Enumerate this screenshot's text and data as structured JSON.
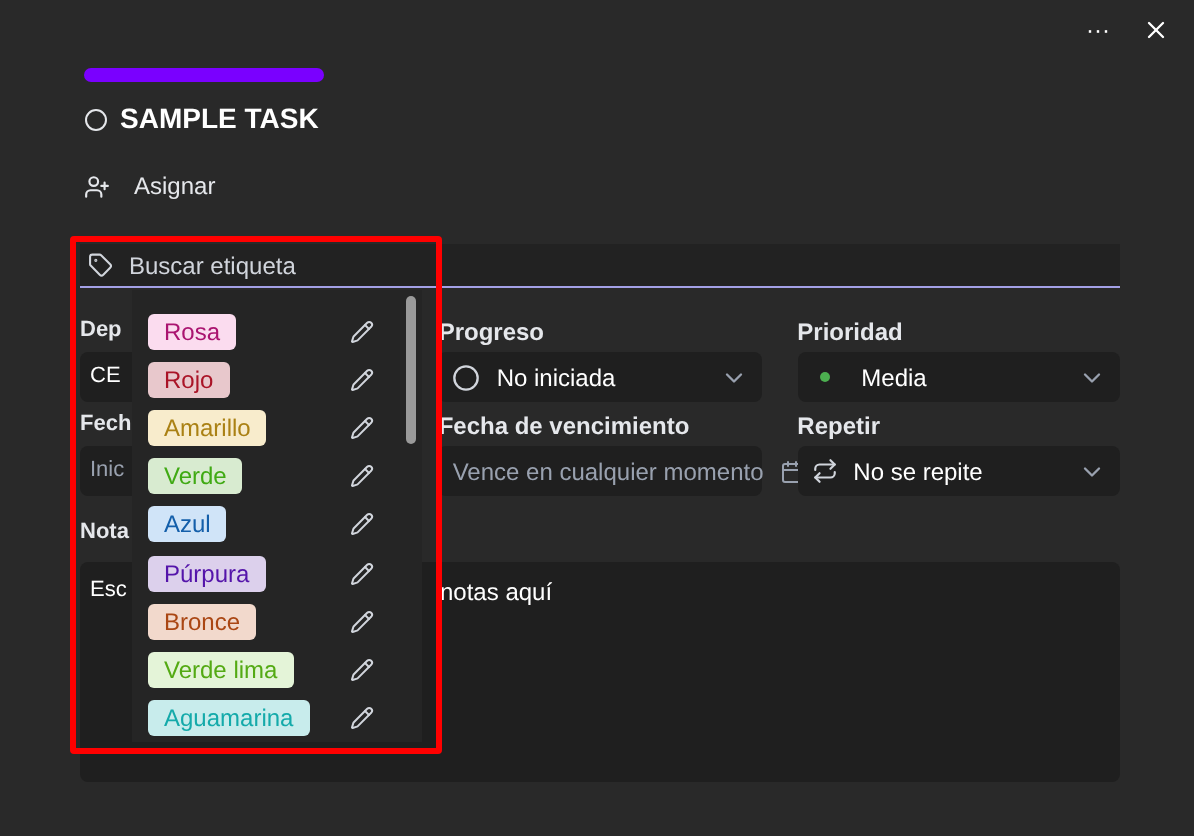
{
  "window": {
    "more_icon": "···"
  },
  "task": {
    "title": "SAMPLE TASK",
    "completed": false,
    "assign": "Asignar"
  },
  "label_search": {
    "placeholder": "Buscar etiqueta"
  },
  "labels": [
    {
      "name": "Rosa",
      "color": "#fbdcef"
    },
    {
      "name": "Rojo",
      "color": "#e8c8cc"
    },
    {
      "name": "Amarillo",
      "color": "#f8eccc"
    },
    {
      "name": "Verde",
      "color": "#d8ebd0"
    },
    {
      "name": "Azul",
      "color": "#d0e4f8"
    },
    {
      "name": "Púrpura",
      "color": "#dcd0ec"
    },
    {
      "name": "Bronce",
      "color": "#f2d9cc"
    },
    {
      "name": "Verde lima",
      "color": "#e4f4d8"
    },
    {
      "name": "Aguamarina",
      "color": "#c8ecec"
    }
  ],
  "fields": [
    {
      "kind": "select",
      "label": "Dep",
      "value": "CE"
    },
    {
      "kind": "progress",
      "label": "Progreso",
      "value": "No iniciada"
    },
    {
      "kind": "priority",
      "label": "Prioridad",
      "value": "Media",
      "color": "#4caf50"
    },
    {
      "kind": "date",
      "label": "Fech",
      "placeholder": "Inic"
    },
    {
      "kind": "date",
      "label": "Fecha de vencimiento",
      "placeholder": "Vence en cualquier momento"
    },
    {
      "kind": "repeat",
      "label": "Repetir",
      "value": "No se repite"
    }
  ],
  "notes": {
    "label": "Nota",
    "text_start": "Esc",
    "text_end": "notas aquí"
  }
}
